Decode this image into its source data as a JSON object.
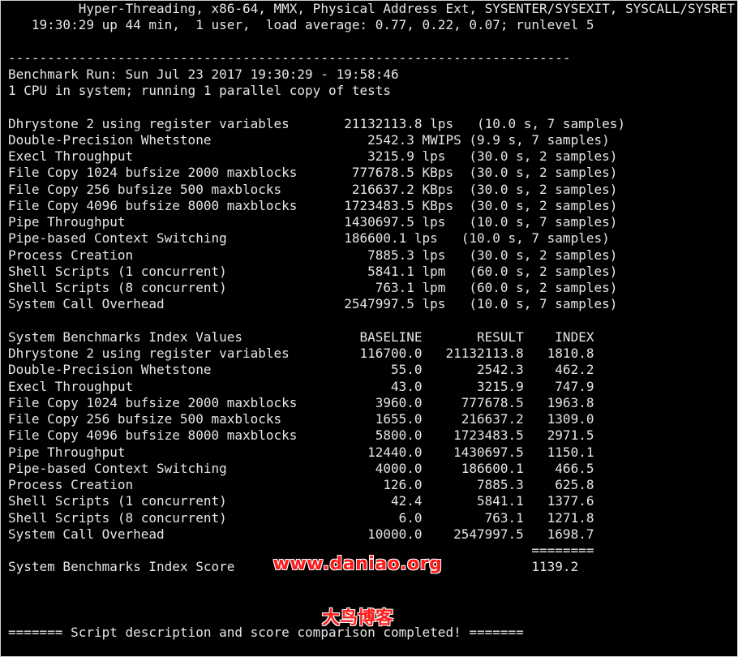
{
  "terminal": {
    "lines": [
      "         Hyper-Threading, x86-64, MMX, Physical Address Ext, SYSENTER/SYSEXIT, SYSCALL/SYSRET",
      "   19:30:29 up 44 min,  1 user,  load average: 0.77, 0.22, 0.07; runlevel 5",
      "",
      "------------------------------------------------------------------------",
      "Benchmark Run: Sun Jul 23 2017 19:30:29 - 19:58:46",
      "1 CPU in system; running 1 parallel copy of tests",
      "",
      "Dhrystone 2 using register variables       21132113.8 lps   (10.0 s, 7 samples)",
      "Double-Precision Whetstone                    2542.3 MWIPS (9.9 s, 7 samples)",
      "Execl Throughput                              3215.9 lps   (30.0 s, 2 samples)",
      "File Copy 1024 bufsize 2000 maxblocks       777678.5 KBps  (30.0 s, 2 samples)",
      "File Copy 256 bufsize 500 maxblocks         216637.2 KBps  (30.0 s, 2 samples)",
      "File Copy 4096 bufsize 8000 maxblocks      1723483.5 KBps  (30.0 s, 2 samples)",
      "Pipe Throughput                            1430697.5 lps   (10.0 s, 7 samples)",
      "Pipe-based Context Switching               186600.1 lps   (10.0 s, 7 samples)",
      "Process Creation                              7885.3 lps   (30.0 s, 2 samples)",
      "Shell Scripts (1 concurrent)                  5841.1 lpm   (60.0 s, 2 samples)",
      "Shell Scripts (8 concurrent)                   763.1 lpm   (60.0 s, 2 samples)",
      "System Call Overhead                       2547997.5 lps   (10.0 s, 7 samples)",
      "",
      "System Benchmarks Index Values               BASELINE       RESULT    INDEX",
      "Dhrystone 2 using register variables         116700.0   21132113.8   1810.8",
      "Double-Precision Whetstone                       55.0       2542.3    462.2",
      "Execl Throughput                                 43.0       3215.9    747.9",
      "File Copy 1024 bufsize 2000 maxblocks          3960.0     777678.5   1963.8",
      "File Copy 256 bufsize 500 maxblocks            1655.0     216637.2   1309.0",
      "File Copy 4096 bufsize 8000 maxblocks          5800.0    1723483.5   2971.5",
      "Pipe Throughput                               12440.0    1430697.5   1150.1",
      "Pipe-based Context Switching                   4000.0     186600.1    466.5",
      "Process Creation                                126.0       7885.3    625.8",
      "Shell Scripts (1 concurrent)                     42.4       5841.1   1377.6",
      "Shell Scripts (8 concurrent)                      6.0        763.1   1271.8",
      "System Call Overhead                          10000.0    2547997.5   1698.7",
      "                                                                   ========",
      "System Benchmarks Index Score                                      1139.2",
      "",
      "",
      "",
      "======= Script description and score comparison completed! ======="
    ]
  },
  "watermark": {
    "url": "www.daniao.org",
    "name": "大鸟博客"
  },
  "colors": {
    "background": "#000000",
    "text": "#e6e6e6",
    "watermark": "#ff1a1a"
  }
}
